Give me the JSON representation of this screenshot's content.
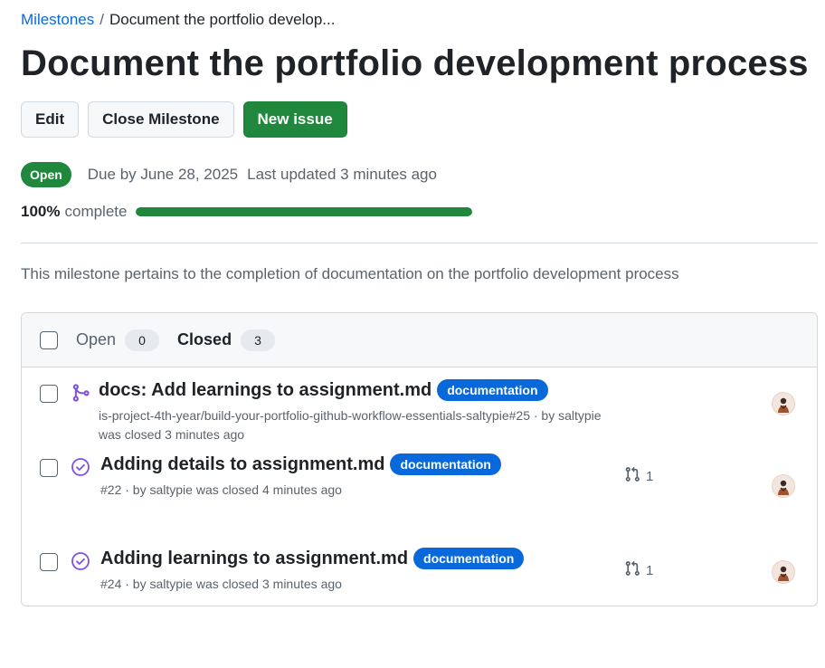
{
  "breadcrumb": {
    "parent_label": "Milestones",
    "current_label": "Document the portfolio develop..."
  },
  "milestone": {
    "title": "Document the portfolio development process",
    "state": "Open",
    "due": "Due by June 28, 2025",
    "updated": "Last updated 3 minutes ago",
    "progress_percent_text": "100%",
    "progress_word": "complete",
    "progress_fraction": 1.0,
    "description": "This milestone pertains to the completion of documentation on the portfolio development process"
  },
  "actions": {
    "edit_label": "Edit",
    "close_label": "Close Milestone",
    "new_issue_label": "New issue"
  },
  "filters": {
    "open_label": "Open",
    "open_count": "0",
    "closed_label": "Closed",
    "closed_count": "3"
  },
  "colors": {
    "accent_green": "#1f883d",
    "label_blue": "#0969da",
    "done_purple": "#8250df"
  },
  "items": [
    {
      "type_icon": "git-merge-icon",
      "title": "docs: Add learnings to assignment.md",
      "label": "documentation",
      "sub_line1": "is-project-4th-year/build-your-portfolio-github-workflow-essentials-saltypie#25 · by saltypie",
      "sub_line2": "was closed 3 minutes ago"
    },
    {
      "type_icon": "issue-closed-icon",
      "title": "Adding details to assignment.md",
      "label": "documentation",
      "sub_line1": "#22 · by saltypie was closed 4 minutes ago",
      "linked_pr_count": "1"
    },
    {
      "type_icon": "issue-closed-icon",
      "title": "Adding learnings to assignment.md",
      "label": "documentation",
      "sub_line1": "#24 · by saltypie was closed 3 minutes ago",
      "linked_pr_count": "1"
    }
  ]
}
